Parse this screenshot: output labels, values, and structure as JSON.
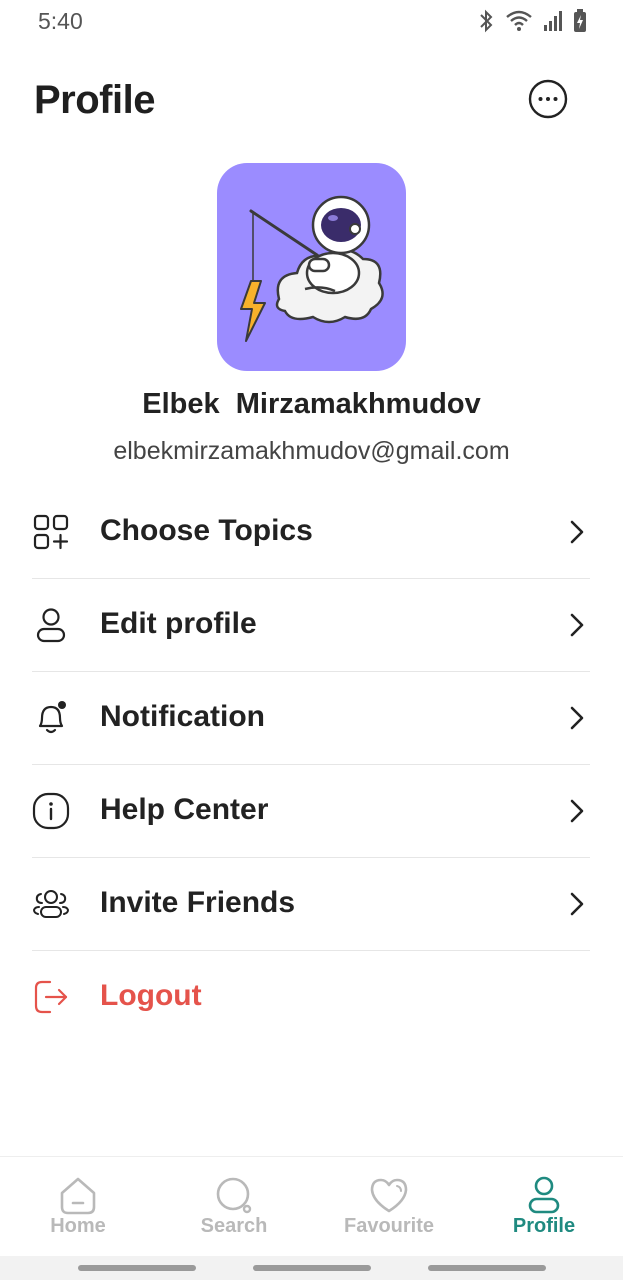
{
  "status_bar": {
    "time": "5:40",
    "icons": [
      "bluetooth-icon",
      "wifi-icon",
      "signal-icon",
      "battery-icon"
    ]
  },
  "header": {
    "title": "Profile",
    "more_icon": "more-horizontal-icon"
  },
  "profile": {
    "name": "Elbek  Mirzamakhmudov",
    "email": "elbekmirzamakhmudov@gmail.com",
    "avatar_color": "#9b8cff",
    "avatar_icon": "astronaut-fishing-illustration"
  },
  "menu": {
    "items": [
      {
        "label": "Choose Topics",
        "icon": "grid-plus-icon"
      },
      {
        "label": "Edit profile",
        "icon": "user-icon"
      },
      {
        "label": "Notification",
        "icon": "bell-icon"
      },
      {
        "label": "Help Center",
        "icon": "info-icon"
      },
      {
        "label": "Invite Friends",
        "icon": "users-icon"
      }
    ],
    "logout": {
      "label": "Logout",
      "icon": "logout-icon",
      "color": "#e5534b"
    }
  },
  "bottom_nav": {
    "items": [
      {
        "label": "Home",
        "icon": "home-icon"
      },
      {
        "label": "Search",
        "icon": "search-icon"
      },
      {
        "label": "Favourite",
        "icon": "heart-icon"
      },
      {
        "label": "Profile",
        "icon": "user-icon"
      }
    ],
    "active": "Profile",
    "active_color": "#1f8a80",
    "inactive_color": "#b9b9b9"
  }
}
